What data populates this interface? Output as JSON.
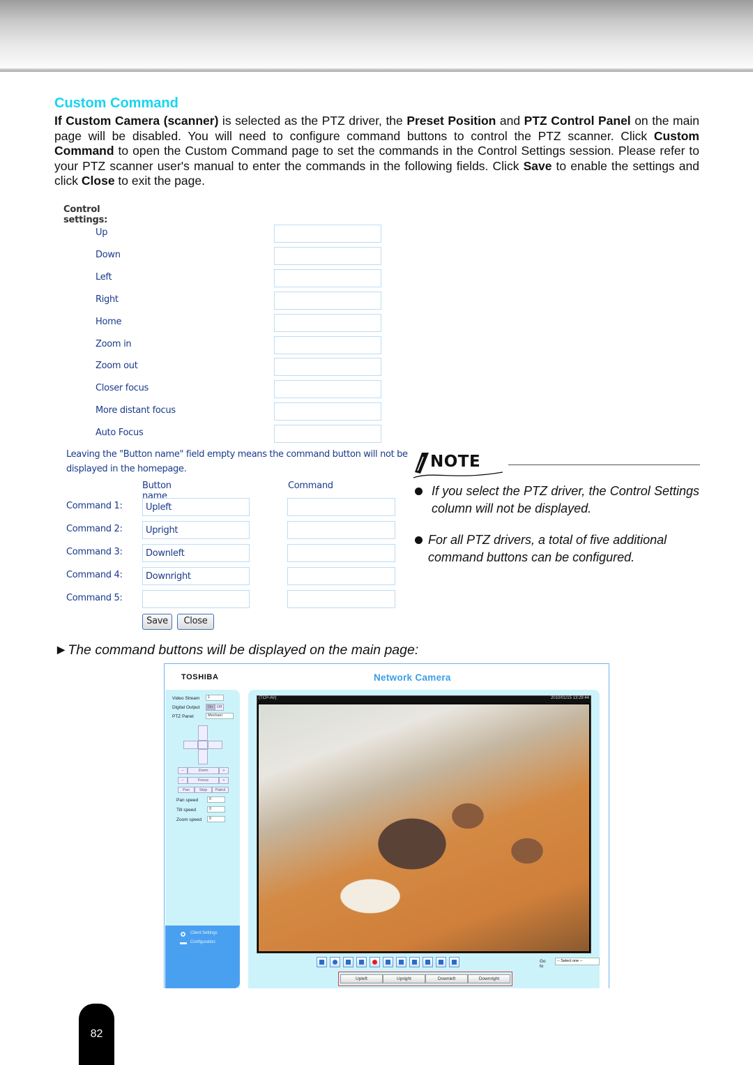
{
  "section": {
    "title": "Custom Command",
    "intro_parts": [
      {
        "t": "If Custom Camera (scanner)",
        "b": true
      },
      {
        "t": " is selected as the PTZ driver, the ",
        "b": false
      },
      {
        "t": "Preset Position",
        "b": true
      },
      {
        "t": " and ",
        "b": false
      },
      {
        "t": "PTZ Control Panel",
        "b": true
      },
      {
        "t": " on the main page will be disabled. You will need to configure command buttons to control the PTZ scanner. Click ",
        "b": false
      },
      {
        "t": "Custom Command",
        "b": true
      },
      {
        "t": " to open the Custom Command page to set the commands in the Control Settings session. Please refer to your PTZ scanner user's manual to enter the commands in the following fields. Click ",
        "b": false
      },
      {
        "t": "Save",
        "b": true
      },
      {
        "t": " to enable the settings and click ",
        "b": false
      },
      {
        "t": "Close",
        "b": true
      },
      {
        "t": " to exit the page.",
        "b": false
      }
    ]
  },
  "control_settings": {
    "title": "Control settings:",
    "fields": [
      {
        "label": "Up",
        "value": ""
      },
      {
        "label": "Down",
        "value": ""
      },
      {
        "label": "Left",
        "value": ""
      },
      {
        "label": "Right",
        "value": ""
      },
      {
        "label": "Home",
        "value": ""
      },
      {
        "label": "Zoom in",
        "value": ""
      },
      {
        "label": "Zoom out",
        "value": ""
      },
      {
        "label": "Closer focus",
        "value": ""
      },
      {
        "label": "More distant focus",
        "value": ""
      },
      {
        "label": "Auto Focus",
        "value": ""
      }
    ]
  },
  "commands": {
    "note": "Leaving the \"Button name\" field empty means the command button will not be displayed in the homepage.",
    "col_button_name": "Button name",
    "col_command": "Command",
    "rows": [
      {
        "label": "Command 1:",
        "name": "Upleft",
        "command": ""
      },
      {
        "label": "Command 2:",
        "name": "Upright",
        "command": ""
      },
      {
        "label": "Command 3:",
        "name": "Downleft",
        "command": ""
      },
      {
        "label": "Command 4:",
        "name": "Downright",
        "command": ""
      },
      {
        "label": "Command 5:",
        "name": "",
        "command": ""
      }
    ],
    "save_label": "Save",
    "close_label": "Close"
  },
  "note_box": {
    "title": "NOTE",
    "bullets": [
      "If you select the PTZ driver, the Control Settings column will not be displayed.",
      "For all PTZ drivers, a total of five additional command buttons can be configured."
    ]
  },
  "caption": "►The command buttons will be displayed on the main page:",
  "camera_page": {
    "logo": "TOSHIBA",
    "title": "Network Camera",
    "video_label": "(TCP-AV)",
    "timestamp": "2010/01/15 13:29:44",
    "sidebar": {
      "video_stream_label": "Video Stream",
      "video_stream_value": "1",
      "digital_output_label": "Digital Output",
      "digital_on": "On",
      "digital_off": "Off",
      "ptz_panel_label": "PTZ Panel",
      "ptz_panel_value": "Mechani",
      "zoom_label": "Zoom",
      "focus_label": "Focus",
      "pan_label": "Pan",
      "stop_label": "Stop",
      "patrol_label": "Patrol",
      "pan_speed_label": "Pan speed",
      "pan_speed_value": "0",
      "tilt_speed_label": "Tilt speed",
      "tilt_speed_value": "0",
      "zoom_speed_label": "Zoom speed",
      "zoom_speed_value": "0",
      "client_settings": "Client Settings",
      "configuration": "Configuration"
    },
    "goto_label": "Go to",
    "goto_value": "-- Select one --",
    "command_buttons": [
      "Upleft",
      "Upright",
      "Downleft",
      "Downright"
    ]
  },
  "page_number": "82",
  "colors": {
    "section_title": "#19d4f0",
    "form_text": "#1a3a8a",
    "camera_title": "#3a9ee8",
    "highlight_box": "#e04040"
  }
}
